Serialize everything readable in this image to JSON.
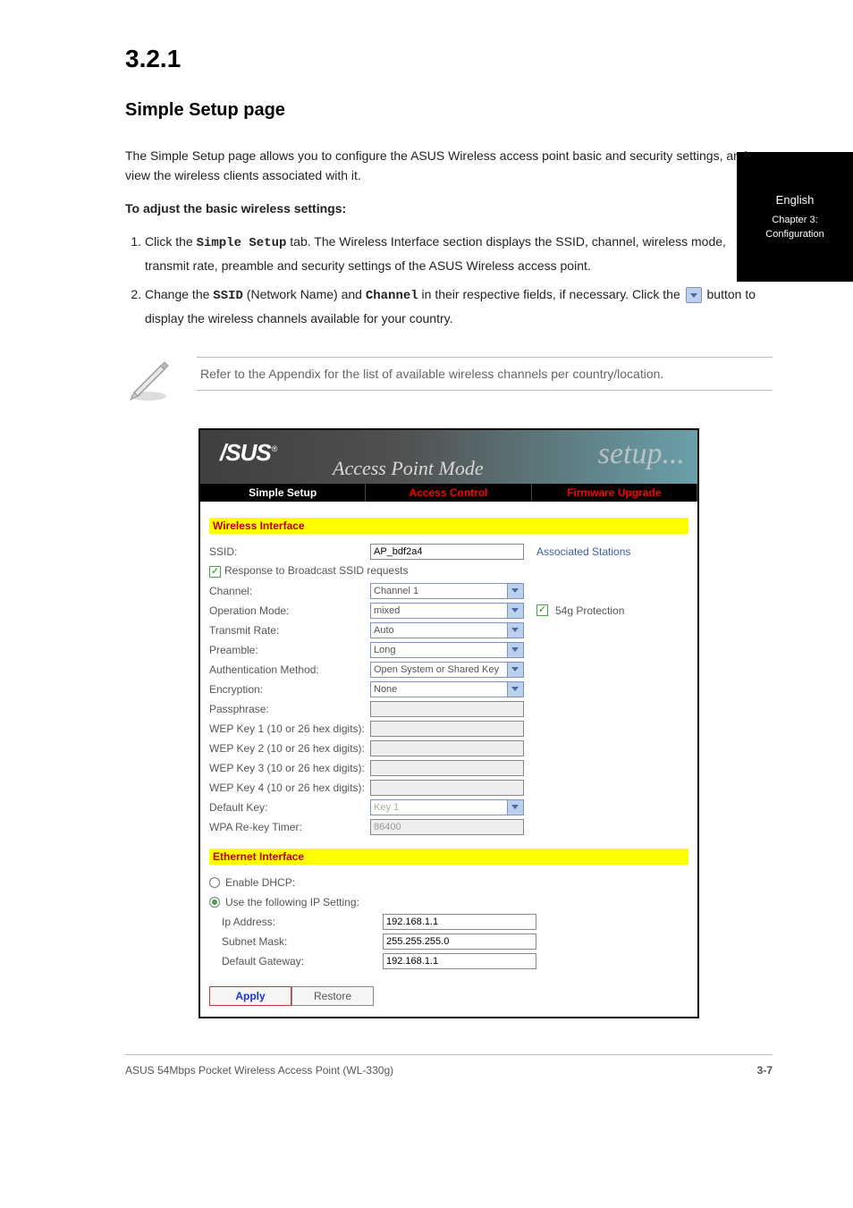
{
  "page": {
    "section_number": "3.2.1",
    "section_title": "Simple Setup page",
    "intro": "The Simple Setup page allows you to configure the ASUS Wireless access point basic and security settings, and view the wireless clients associated with it.",
    "to_adjust_title": "To adjust the basic wireless settings:",
    "step1_prefix": "Click the ",
    "step1_tab": "Simple Setup",
    "step1_suffix": " tab. The Wireless Interface section displays the SSID, channel, wireless mode, transmit rate, preamble and security settings of the ASUS Wireless access point.",
    "step2a": "Change the ",
    "step2b": "SSID",
    "step2c": " (Network Name) and ",
    "step2d": "Channel",
    "step2e": " in their respective fields, if necessary. Click the ",
    "step2f": " button to display the wireless channels available for your country.",
    "note_text": "Refer to the Appendix for the list of available wireless channels per country/location.",
    "footer_left": "ASUS 54Mbps Pocket Wireless Access Point (WL-330g)",
    "footer_right": "3-7",
    "tab_label": "English",
    "tab_sub": "Chapter 3: Configuration"
  },
  "shot": {
    "logo": "/SUS",
    "logo_r": "®",
    "mode": "Access Point Mode",
    "setup": "setup...",
    "tabs": [
      "Simple Setup",
      "Access Control",
      "Firmware Upgrade"
    ],
    "wi_head": "Wireless Interface",
    "ei_head": "Ethernet Interface",
    "assoc": "Associated Stations",
    "labels": {
      "ssid": "SSID:",
      "resp": "Response to Broadcast SSID requests",
      "channel": "Channel:",
      "opmode": "Operation Mode:",
      "txrate": "Transmit Rate:",
      "preamble": "Preamble:",
      "auth": "Authentication Method:",
      "enc": "Encryption:",
      "pass": "Passphrase:",
      "wep1": "WEP Key 1 (10 or 26 hex digits):",
      "wep2": "WEP Key 2 (10 or 26 hex digits):",
      "wep3": "WEP Key 3 (10 or 26 hex digits):",
      "wep4": "WEP Key 4 (10 or 26 hex digits):",
      "defkey": "Default Key:",
      "wpa": "WPA Re-key Timer:",
      "dhcp": "Enable DHCP:",
      "useip": "Use the following IP Setting:",
      "ip": "Ip Address:",
      "mask": "Subnet Mask:",
      "gw": "Default Gateway:"
    },
    "values": {
      "ssid": "AP_bdf2a4",
      "channel": "Channel 1",
      "opmode": "mixed",
      "opmode_extra": "54g Protection",
      "txrate": "Auto",
      "preamble": "Long",
      "auth": "Open System or Shared Key",
      "enc": "None",
      "defkey": "Key 1",
      "wpa": "86400",
      "ip": "192.168.1.1",
      "mask": "255.255.255.0",
      "gw": "192.168.1.1"
    },
    "apply": "Apply",
    "restore": "Restore"
  }
}
